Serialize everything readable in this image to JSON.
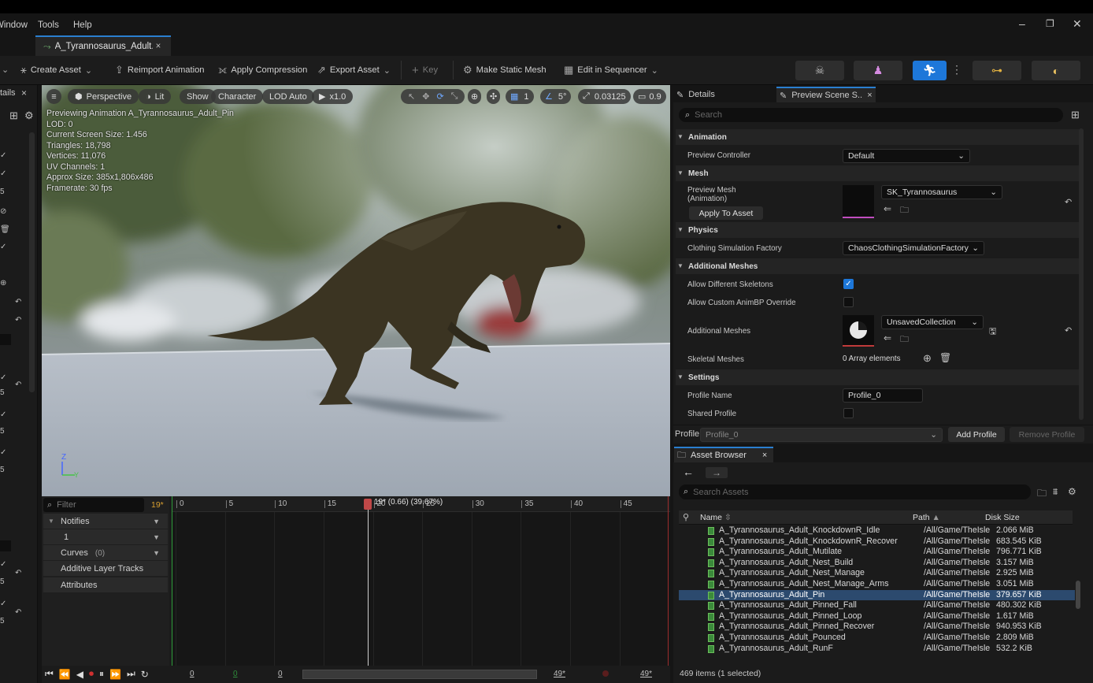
{
  "menu": {
    "items": [
      "Window",
      "Tools",
      "Help"
    ]
  },
  "window": {
    "tab_title": "A_Tyrannosaurus_Adult...",
    "tab_close": "×",
    "minimize": "–",
    "restore": "❐",
    "close": "✕"
  },
  "toolbar": {
    "create_asset": "Create Asset",
    "reimport": "Reimport Animation",
    "apply_compression": "Apply Compression",
    "export_asset": "Export Asset",
    "key": "Key",
    "make_static_mesh": "Make Static Mesh",
    "edit_in_sequencer": "Edit in Sequencer"
  },
  "left_panel": {
    "tab_label": "tails",
    "close": "×"
  },
  "viewport": {
    "buttons": {
      "perspective": "Perspective",
      "lit": "Lit",
      "show": "Show",
      "character": "Character",
      "lod": "LOD Auto",
      "speed": "x1.0",
      "grid_value": "1",
      "angle_value": "5°",
      "scale_value": "0.03125",
      "camera_value": "0.9"
    },
    "stats": [
      "Previewing Animation A_Tyrannosaurus_Adult_Pin",
      "LOD: 0",
      "Current Screen Size: 1.456",
      "Triangles: 18,798",
      "Vertices: 11,076",
      "UV Channels: 1",
      "Approx Size: 385x1,806x486",
      "Framerate: 30 fps"
    ],
    "axis": {
      "z": "Z",
      "y": "Y"
    }
  },
  "timeline": {
    "filter_placeholder": "Filter",
    "frame_badge": "19*",
    "notifies": "Notifies",
    "track_number": "1",
    "curves": "Curves",
    "curves_count": "(0)",
    "additive": "Additive Layer Tracks",
    "attributes": "Attributes",
    "ticks": [
      "0",
      "5",
      "10",
      "15",
      "20",
      "25",
      "30",
      "35",
      "40",
      "45"
    ],
    "playhead_label": "19* (0.66) (39.67%)",
    "playhead_fraction": 0.3967
  },
  "transport": {
    "start": "0",
    "green": "0",
    "current": "0",
    "end1": "49*",
    "end2": "49*"
  },
  "details": {
    "tab_details": "Details",
    "tab_preview": "Preview Scene S...",
    "tab_close": "×",
    "search_placeholder": "Search",
    "sections": {
      "animation": "Animation",
      "mesh": "Mesh",
      "physics": "Physics",
      "additional_meshes": "Additional Meshes",
      "settings": "Settings"
    },
    "props": {
      "preview_controller": "Preview Controller",
      "preview_controller_value": "Default",
      "preview_mesh": "Preview Mesh",
      "preview_mesh_sub": "(Animation)",
      "preview_mesh_value": "SK_Tyrannosaurus",
      "apply_to_asset": "Apply To Asset",
      "clothing": "Clothing Simulation Factory",
      "clothing_value": "ChaosClothingSimulationFactory",
      "allow_skeletons": "Allow Different Skeletons",
      "allow_skeletons_checked": true,
      "allow_animbp": "Allow Custom AnimBP Override",
      "allow_animbp_checked": false,
      "additional_meshes": "Additional Meshes",
      "additional_meshes_value": "UnsavedCollection",
      "skeletal_meshes": "Skeletal Meshes",
      "skeletal_meshes_value": "0 Array elements",
      "profile_name": "Profile Name",
      "profile_name_value": "Profile_0",
      "shared_profile": "Shared Profile",
      "shared_profile_checked": false
    },
    "profile_bar": {
      "label": "Profile",
      "value": "Profile_0",
      "add": "Add Profile",
      "remove": "Remove Profile"
    }
  },
  "asset_browser": {
    "title": "Asset Browser",
    "close": "×",
    "search_placeholder": "Search Assets",
    "columns": {
      "name": "Name",
      "path": "Path",
      "size": "Disk Size"
    },
    "rows": [
      {
        "name": "A_Tyrannosaurus_Adult_KnockdownR_Idle",
        "path": "/All/Game/TheIsle",
        "size": "2.066 MiB"
      },
      {
        "name": "A_Tyrannosaurus_Adult_KnockdownR_Recover",
        "path": "/All/Game/TheIsle",
        "size": "683.545 KiB"
      },
      {
        "name": "A_Tyrannosaurus_Adult_Mutilate",
        "path": "/All/Game/TheIsle",
        "size": "796.771 KiB"
      },
      {
        "name": "A_Tyrannosaurus_Adult_Nest_Build",
        "path": "/All/Game/TheIsle",
        "size": "3.157 MiB"
      },
      {
        "name": "A_Tyrannosaurus_Adult_Nest_Manage",
        "path": "/All/Game/TheIsle",
        "size": "2.925 MiB"
      },
      {
        "name": "A_Tyrannosaurus_Adult_Nest_Manage_Arms",
        "path": "/All/Game/TheIsle",
        "size": "3.051 MiB"
      },
      {
        "name": "A_Tyrannosaurus_Adult_Pin",
        "path": "/All/Game/TheIsle",
        "size": "379.657 KiB",
        "selected": true
      },
      {
        "name": "A_Tyrannosaurus_Adult_Pinned_Fall",
        "path": "/All/Game/TheIsle",
        "size": "480.302 KiB"
      },
      {
        "name": "A_Tyrannosaurus_Adult_Pinned_Loop",
        "path": "/All/Game/TheIsle",
        "size": "1.617 MiB"
      },
      {
        "name": "A_Tyrannosaurus_Adult_Pinned_Recover",
        "path": "/All/Game/TheIsle",
        "size": "940.953 KiB"
      },
      {
        "name": "A_Tyrannosaurus_Adult_Pounced",
        "path": "/All/Game/TheIsle",
        "size": "2.809 MiB"
      },
      {
        "name": "A_Tyrannosaurus_Adult_RunF",
        "path": "/All/Game/TheIsle",
        "size": "532.2 KiB"
      }
    ],
    "status": "469 items (1 selected)"
  },
  "colors": {
    "accent": "#2a7fd0",
    "mode_active": "#1d77d9",
    "selected_row": "#2c4a6e",
    "playhead": "#c04848"
  }
}
